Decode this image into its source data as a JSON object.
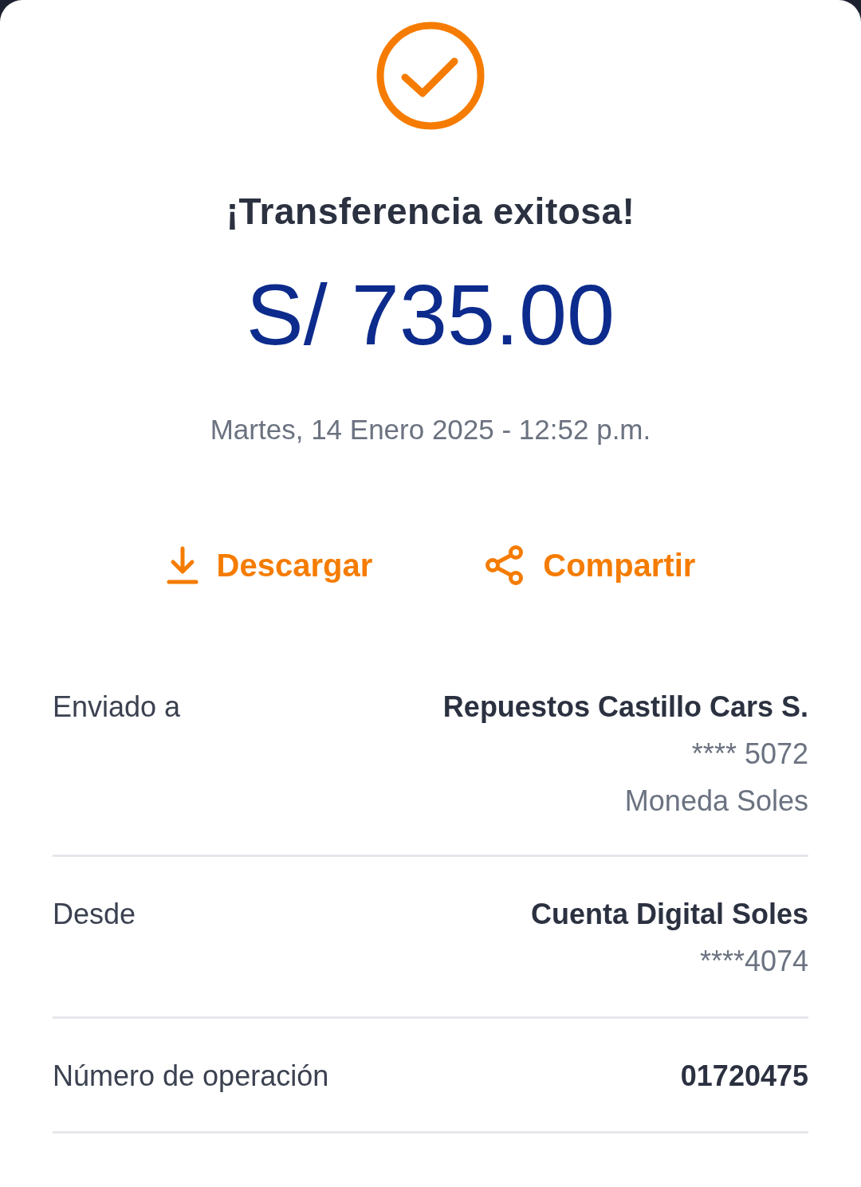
{
  "status": {
    "title": "¡Transferencia exitosa!"
  },
  "amount": "S/ 735.00",
  "datetime": "Martes, 14 Enero 2025 - 12:52 p.m.",
  "actions": [
    {
      "kind": "download",
      "label": "Descargar"
    },
    {
      "kind": "share",
      "label": "Compartir"
    }
  ],
  "details": [
    {
      "label": "Enviado a",
      "lines": [
        "Repuestos Castillo Cars S.",
        "**** 5072",
        "Moneda Soles"
      ]
    },
    {
      "label": "Desde",
      "lines": [
        "Cuenta Digital Soles",
        "****4074"
      ]
    },
    {
      "label": "Número de operación",
      "lines": [
        "01720475"
      ]
    }
  ]
}
